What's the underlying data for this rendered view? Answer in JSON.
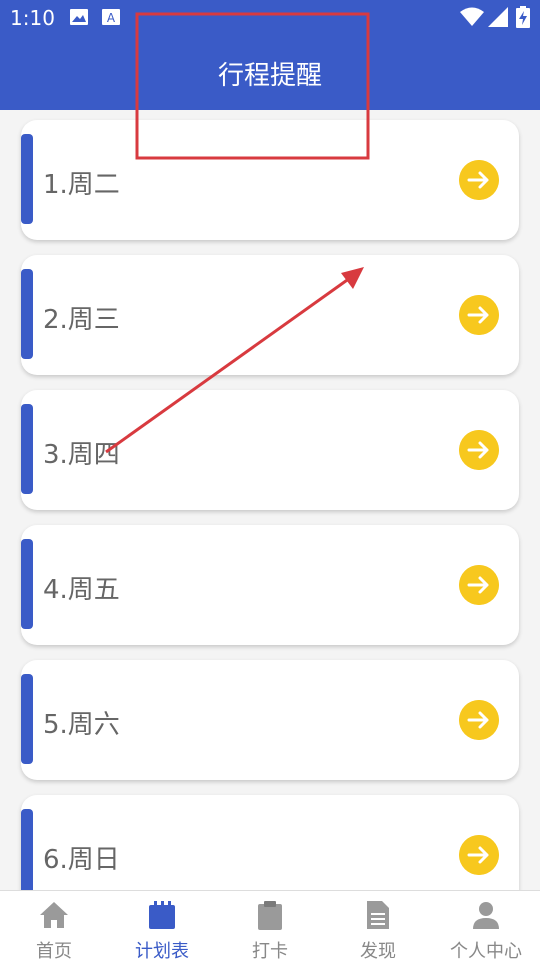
{
  "status_bar": {
    "time": "1:10",
    "icons": [
      "image-icon",
      "font-a-icon",
      "wifi-icon",
      "signal-icon",
      "battery-charging-icon"
    ]
  },
  "header": {
    "title": "行程提醒"
  },
  "schedule": {
    "items": [
      {
        "label": "1.周二",
        "icon": "arrow-right-circle-icon"
      },
      {
        "label": "2.周三",
        "icon": "arrow-right-circle-icon"
      },
      {
        "label": "3.周四",
        "icon": "arrow-right-circle-icon"
      },
      {
        "label": "4.周五",
        "icon": "arrow-right-circle-icon"
      },
      {
        "label": "5.周六",
        "icon": "arrow-right-circle-icon"
      },
      {
        "label": "6.周日",
        "icon": "arrow-right-circle-icon"
      }
    ]
  },
  "tabbar": {
    "tabs": [
      {
        "label": "首页",
        "icon": "home-icon"
      },
      {
        "label": "计划表",
        "icon": "calendar-icon",
        "active": true
      },
      {
        "label": "打卡",
        "icon": "clipboard-icon"
      },
      {
        "label": "发现",
        "icon": "document-icon"
      },
      {
        "label": "个人中心",
        "icon": "user-icon"
      }
    ]
  },
  "colors": {
    "primary": "#3a5bc7",
    "accent": "#f7c81e",
    "annotation": "#d83a3f",
    "text_muted": "#666666",
    "tab_inactive": "#888888"
  }
}
